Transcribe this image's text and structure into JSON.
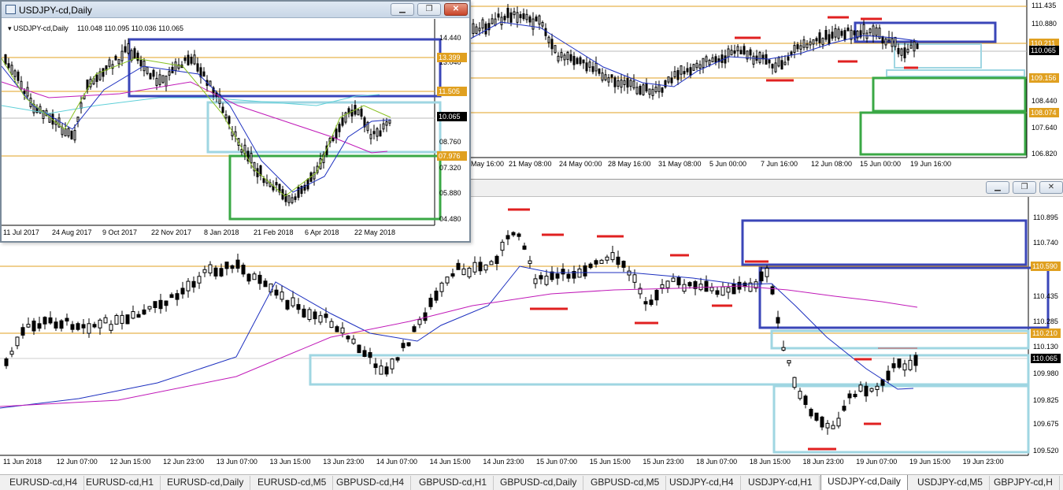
{
  "inset_window": {
    "title": "USDJPY-cd,Daily",
    "header_symbol": "USDJPY-cd,Daily",
    "header_values": "110.048 110.095 110.036 110.065",
    "price_labels": [
      "14.440",
      "13.040",
      "11.505",
      "10.065",
      "08.760",
      "07.320",
      "05.880",
      "04.480",
      "13.399",
      "07.976"
    ],
    "date_labels": [
      "11 Jul 2017",
      "24 Aug 2017",
      "9 Oct 2017",
      "22 Nov 2017",
      "8 Jan 2018",
      "21 Feb 2018",
      "6 Apr 2018",
      "22 May 2018"
    ]
  },
  "top_chart": {
    "price_labels": [
      "111.435",
      "110.880",
      "110.211",
      "110.065",
      "109.156",
      "108.440",
      "108.074",
      "107.640",
      "106.820"
    ],
    "date_labels": [
      "May 16:00",
      "21 May 08:00",
      "24 May 00:00",
      "28 May 16:00",
      "31 May 08:00",
      "5 Jun 00:00",
      "7 Jun 16:00",
      "12 Jun 08:00",
      "15 Jun 00:00",
      "19 Jun 16:00"
    ]
  },
  "bottom_chart": {
    "price_labels": [
      "110.895",
      "110.740",
      "110.590",
      "110.435",
      "110.285",
      "110.210",
      "110.130",
      "110.065",
      "109.980",
      "109.825",
      "109.675",
      "109.520"
    ],
    "date_labels": [
      "11 Jun 2018",
      "12 Jun 07:00",
      "12 Jun 15:00",
      "12 Jun 23:00",
      "13 Jun 07:00",
      "13 Jun 15:00",
      "13 Jun 23:00",
      "14 Jun 07:00",
      "14 Jun 15:00",
      "14 Jun 23:00",
      "15 Jun 07:00",
      "15 Jun 15:00",
      "15 Jun 23:00",
      "18 Jun 07:00",
      "18 Jun 15:00",
      "18 Jun 23:00",
      "19 Jun 07:00",
      "19 Jun 15:00",
      "19 Jun 23:00"
    ]
  },
  "window_controls": {
    "minimize": "▁",
    "restore": "❐",
    "close": "✕"
  },
  "tabs": [
    "EURUSD-cd,H4",
    "EURUSD-cd,H1",
    "EURUSD-cd,Daily",
    "EURUSD-cd,M5",
    "GBPUSD-cd,H4",
    "GBPUSD-cd,H1",
    "GBPUSD-cd,Daily",
    "GBPUSD-cd,M5",
    "USDJPY-cd,H4",
    "USDJPY-cd,H1",
    "USDJPY-cd,Daily",
    "USDJPY-cd,M5",
    "GBPJPY-cd,H"
  ],
  "active_tab": "USDJPY-cd,Daily",
  "colors": {
    "blue_zone": "#3a46b8",
    "light_blue_zone": "#9fd6e2",
    "green_zone": "#3aa845",
    "orange_level": "#e0a020",
    "red_mark": "#e02020",
    "ma_blue": "#1c2fbf",
    "ma_magenta": "#c019b8",
    "ma_cyan": "#5fd0d8",
    "ma_green": "#88c020"
  }
}
